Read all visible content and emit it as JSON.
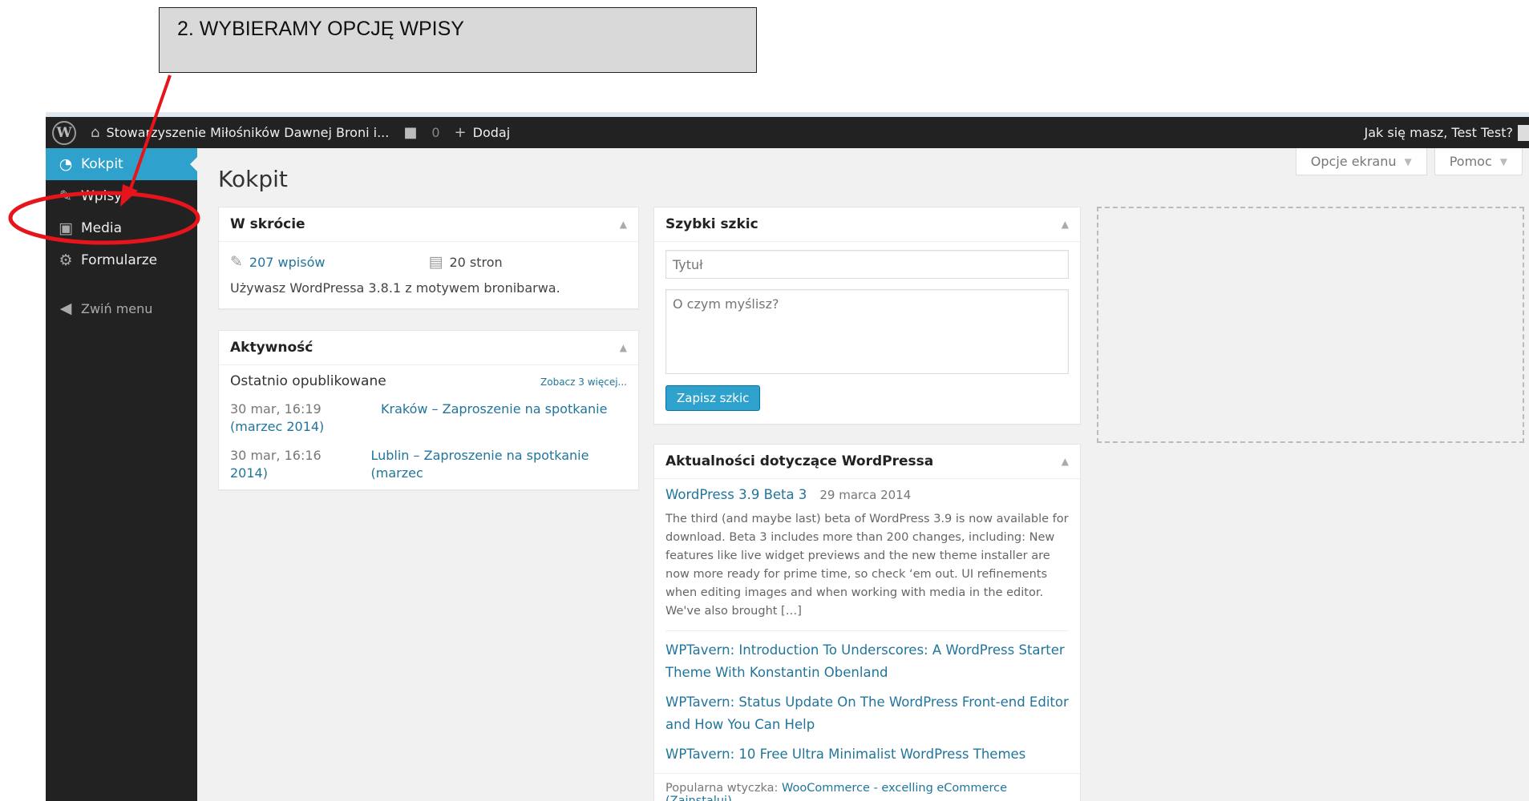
{
  "annotation": {
    "callout_text": "2. WYBIERAMY OPCJĘ WPISY",
    "arrow_color": "#e8141c"
  },
  "adminbar": {
    "site_name": "Stowarzyszenie Miłośników Dawnej Broni i...",
    "comments_count": "0",
    "new_label": "Dodaj",
    "howdy": "Jak się masz, Test Test?"
  },
  "sidebar": {
    "items": [
      {
        "label": "Kokpit",
        "icon": "dashboard-icon"
      },
      {
        "label": "Wpisy",
        "icon": "pin-icon"
      },
      {
        "label": "Media",
        "icon": "media-icon"
      },
      {
        "label": "Formularze",
        "icon": "gear-icon"
      }
    ],
    "collapse_label": "Zwiń menu"
  },
  "screen_options": {
    "options_label": "Opcje ekranu",
    "help_label": "Pomoc"
  },
  "page_title": "Kokpit",
  "at_a_glance": {
    "title": "W skrócie",
    "posts": "207 wpisów",
    "pages": "20 stron",
    "version_text": "Używasz WordPressa 3.8.1 z motywem bronibarwa."
  },
  "activity": {
    "title": "Aktywność",
    "recently_published": "Ostatnio opublikowane",
    "see_more": "Zobacz 3 więcej...",
    "rows": [
      {
        "date": "30 mar, 16:19",
        "title": "Kraków – Zaproszenie na spotkanie",
        "title_rest": "(marzec 2014)"
      },
      {
        "date": "30 mar, 16:16",
        "title": "Lublin – Zaproszenie na spotkanie (marzec",
        "title_rest": "2014)"
      }
    ]
  },
  "quick_draft": {
    "title": "Szybki szkic",
    "title_placeholder": "Tytuł",
    "content_placeholder": "O czym myślisz?",
    "save_label": "Zapisz szkic"
  },
  "news": {
    "title": "Aktualności dotyczące WordPressa",
    "main_title": "WordPress 3.9 Beta 3",
    "main_date": "29 marca 2014",
    "main_body": "The third (and maybe last) beta of WordPress 3.9 is now available for download. Beta 3 includes more than 200 changes, including: New features like live widget previews and the new theme installer are now more ready for prime time, so check ‘em out. UI refinements when editing images and when working with media in the editor. We've also brought […]",
    "links": [
      "WPTavern: Introduction To Underscores: A WordPress Starter Theme With Konstantin Obenland",
      "WPTavern: Status Update On The WordPress Front-end Editor and How You Can Help",
      "WPTavern: 10 Free Ultra Minimalist WordPress Themes"
    ],
    "popular_prefix": "Popularna wtyczka:",
    "popular_link": "WooCommerce - excelling eCommerce",
    "popular_install": "(Zainstaluj)"
  },
  "colors": {
    "admin_bar": "#222222",
    "accent": "#2ea2cc",
    "link": "#21759b",
    "background": "#f1f1f1"
  }
}
